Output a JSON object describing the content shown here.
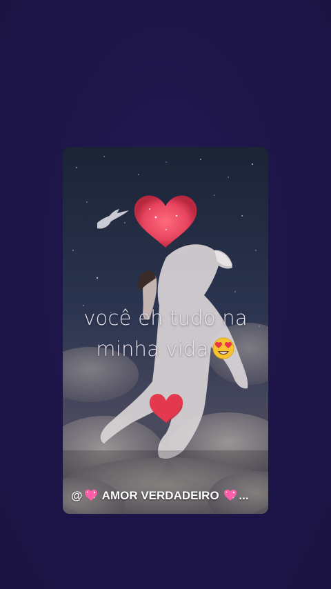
{
  "post": {
    "caption_line1": "você eh tudo na",
    "caption_line2": "minha vida",
    "caption_emoji": "heart-eyes-emoji",
    "author_prefix": "@",
    "author_name": " AMOR VERDADEIRO ",
    "author_suffix": "...",
    "author_emoji": "sparkling-heart-emoji"
  },
  "colors": {
    "background": "#1e1548",
    "heart": "#e8455f",
    "caption_text": "#e6e1ee"
  },
  "icons": [
    "big-heart-sticker",
    "small-heart-sticker",
    "dove-icon",
    "white-horse-image"
  ]
}
